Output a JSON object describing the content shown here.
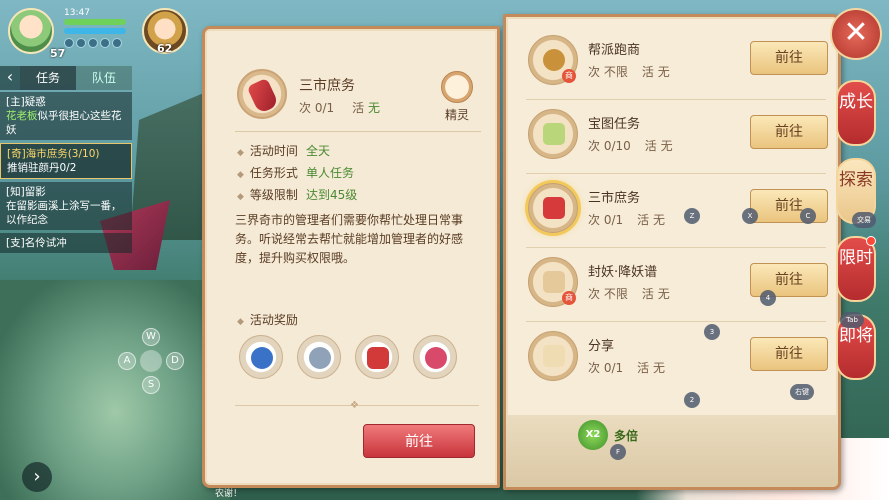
{
  "hud": {
    "time": "13:47",
    "player_level": "57",
    "pet_level": "62"
  },
  "quest_panel": {
    "tab_task": "任务",
    "tab_team": "队伍",
    "items": [
      {
        "title": "[主]疑惑",
        "desc_prefix": "",
        "desc_highlight": "花老板",
        "desc": "似乎很担心这些花妖"
      },
      {
        "title": "[奇]海市庶务(3/10)",
        "desc_prefix": "推销驻颜丹0/2",
        "desc_highlight": "",
        "desc": ""
      },
      {
        "title": "[知]留影",
        "desc_prefix": "在留影画溪上涂写一番，以作纪念",
        "desc_highlight": "",
        "desc": ""
      },
      {
        "title": "[支]名伶试冲",
        "desc_prefix": "",
        "desc_highlight": "",
        "desc": ""
      }
    ]
  },
  "dpad": {
    "up": "W",
    "left": "A",
    "right": "D",
    "down": "S"
  },
  "bottom_text": "农谢！",
  "detail": {
    "title": "三市庶务",
    "count_label": "次",
    "count_value": "0/1",
    "vigor_label": "活",
    "vigor_value": "无",
    "spirit_label": "精灵",
    "attrs": [
      {
        "label": "活动时间",
        "value": "全天"
      },
      {
        "label": "任务形式",
        "value": "单人任务"
      },
      {
        "label": "等级限制",
        "value": "达到45级"
      }
    ],
    "description": "三界奇市的管理者们需要你帮忙处理日常事务。听说经常去帮忙就能增加管理者的好感度，提升购买权限哦。",
    "reward_title": "活动奖励",
    "go_label": "前往"
  },
  "task_list": [
    {
      "name": "帮派跑商",
      "count": "不限",
      "vigor": "无",
      "go": "前往",
      "selected": false,
      "badge": "商"
    },
    {
      "name": "宝图任务",
      "count": "0/10",
      "vigor": "无",
      "go": "前往",
      "selected": false,
      "badge": ""
    },
    {
      "name": "三市庶务",
      "count": "0/1",
      "vigor": "无",
      "go": "前往",
      "selected": true,
      "badge": ""
    },
    {
      "name": "封妖·降妖谱",
      "count": "不限",
      "vigor": "无",
      "go": "前往",
      "selected": false,
      "badge": "商"
    },
    {
      "name": "分享",
      "count": "0/1",
      "vigor": "无",
      "go": "前往",
      "selected": false,
      "badge": ""
    }
  ],
  "task_labels": {
    "count": "次",
    "vigor": "活"
  },
  "multiplier": {
    "badge": "X2",
    "label": "多倍"
  },
  "side_tabs": [
    {
      "label": "成长"
    },
    {
      "label": "探索"
    },
    {
      "label": "限时"
    },
    {
      "label": "即将"
    }
  ],
  "close_symbol": "✕",
  "key_hints": [
    "Z",
    "X",
    "C",
    "4",
    "3",
    "2",
    "F",
    "交易",
    "Tab",
    "右键"
  ],
  "colors": {
    "accent_red": "#c8343c",
    "panel_bg": "#f5ead6",
    "highlight_green": "#4a8a32"
  }
}
